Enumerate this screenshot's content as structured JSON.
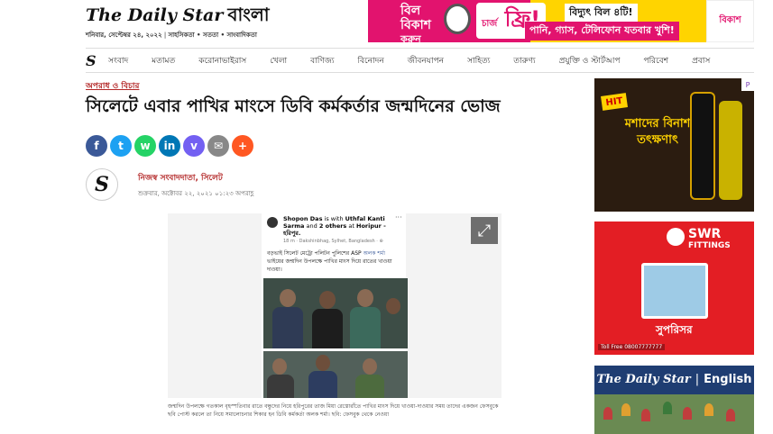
{
  "header": {
    "logo_en": "The Daily Star",
    "logo_bn": "বাংলা",
    "date": "শনিবার, সেপ্টেম্বর ২৪, ২০২২",
    "tagline": "সাহসিকতা • সততা • সাংবাদিকতা"
  },
  "top_ad": {
    "bill": "বিল",
    "bkash_word": "বিকাশ",
    "karun": "করুন",
    "charge": "চার্জ",
    "free": "ফ্রি!",
    "line1": "বিদ্যুৎ বিল ৪টি!",
    "line2": "পানি, গ্যাস, টেলিফোন যতবার খুশি!",
    "brand": "বিকাশ"
  },
  "nav": {
    "items": [
      "সংবাদ",
      "মতামত",
      "করোনাভাইরাস",
      "খেলা",
      "বাণিজ্য",
      "বিনোদন",
      "জীবনযাপন",
      "সাহিত্য",
      "তারুণ্য",
      "প্রযুক্তি ও স্টার্টআপ",
      "পরিবেশ",
      "প্রবাস"
    ]
  },
  "article": {
    "kicker": "অপরাধ ও বিচার",
    "headline": "সিলেটে এবার পাখির মাংসে ডিবি কর্মকর্তার জন্মদিনের ভোজ",
    "byline": "নিজস্ব সংবাদদাতা, সিলেট",
    "published": "শুক্রবার, অক্টোবর ২২, ২০২১ ০১:২৩ অপরাহ্ণ",
    "caption": "জন্মদিন উপলক্ষে গতকাল বৃহস্পতিবার রাতে বন্ধুদের নিয়ে হরিপুরের তাজ মিয়া রেস্তোরাঁতে পাখির মাংস দিয়ে খাওয়া-দাওয়ার সময় তাদের একজন ফেসবুকে ছবি পোস্ট করলে তা নিয়ে সমালোচনার শিকার হন ডিবি কর্মকর্তা অলক শর্মা। ছবি: ফেসবুক থেকে নেওয়া"
  },
  "post": {
    "author": "Shopon Das",
    "with": "is with",
    "tagged": "Uthfal Kanti Sarma",
    "and": "and",
    "others": "2 others",
    "at": "at",
    "place": "Horipur - হরিপুর.",
    "meta": "18 m · Dakshinbhag, Sylhet, Bangladesh · ⊕",
    "text_before": "বড়ভাই সিলেট মেট্রো পলিটন পুলিশের ASP",
    "text_name": "অলক শর্মা",
    "text_after": "ভাইয়ের জন্মদিন উপলক্ষে পাখির মাংস দিয়ে রাতের খাওয়া দাওয়া।"
  },
  "sidebar": {
    "ad1": {
      "brand": "HIT",
      "text": "মশাদের বিনাশ তৎক্ষণাৎ"
    },
    "ad2": {
      "brand": "SWR",
      "sub": "FITTINGS",
      "word": "সুপরিসর",
      "phone": "Toll Free 08007777777"
    },
    "ad3": {
      "logo": "The Daily Star",
      "sep": "|",
      "word": "English"
    }
  },
  "icons": {
    "facebook": "f",
    "twitter": "t",
    "whatsapp": "w",
    "linkedin": "in",
    "viber": "v",
    "email": "✉",
    "plus": "+",
    "expand": "⤢",
    "nav_logo": "S",
    "author_avatar": "S",
    "dots": "···",
    "ad_choice": "P"
  },
  "colors": {
    "accent": "#b32727",
    "bkash_pink": "#e2136e",
    "ad_yellow": "#ffd400"
  }
}
